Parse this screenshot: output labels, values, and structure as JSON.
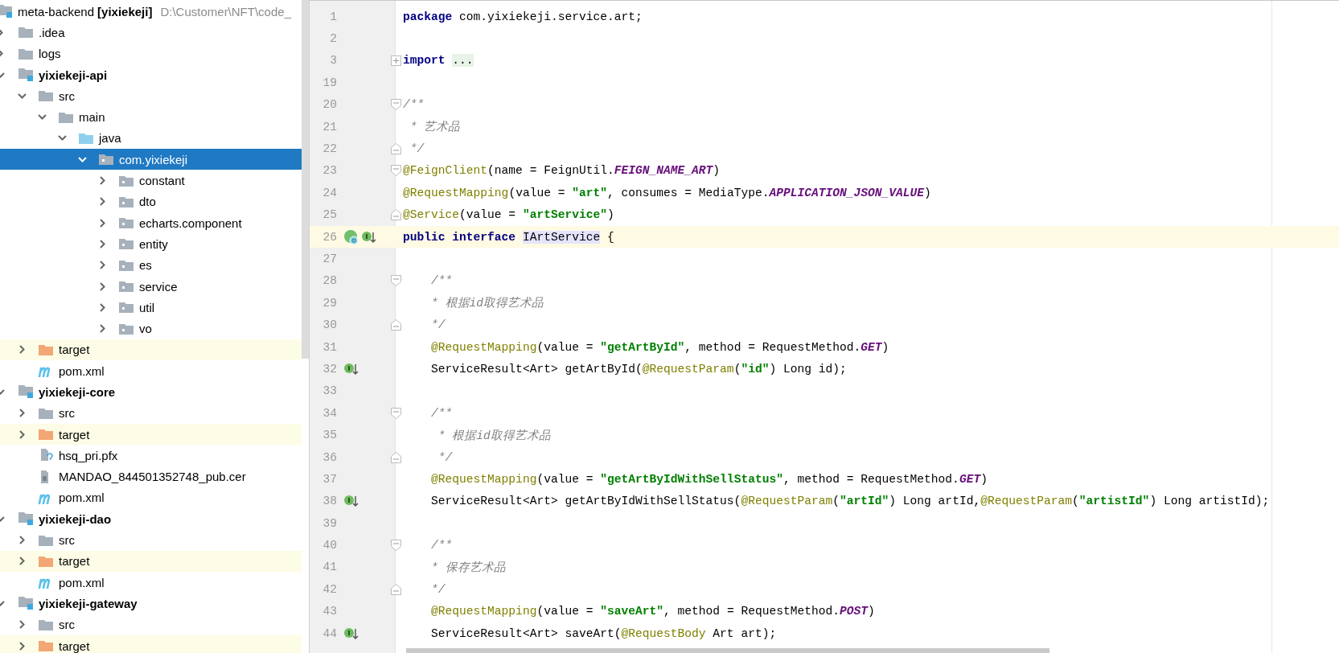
{
  "project_tree": {
    "root": {
      "label": "meta-backend",
      "module": "[yixiekeji]",
      "path": "D:\\Customer\\NFT\\code_"
    },
    "items": [
      {
        "label": ".idea",
        "kind": "folder",
        "expanded": false,
        "selected": false
      },
      {
        "label": "logs",
        "kind": "folder",
        "expanded": false,
        "selected": false
      },
      {
        "label": "yixiekeji-api",
        "kind": "module",
        "expanded": true,
        "selected": false,
        "children": [
          {
            "label": "src",
            "kind": "folder",
            "expanded": true,
            "selected": false,
            "children": [
              {
                "label": "main",
                "kind": "folder",
                "expanded": true,
                "selected": false,
                "children": [
                  {
                    "label": "java",
                    "kind": "source",
                    "expanded": true,
                    "selected": false,
                    "children": [
                      {
                        "label": "com.yixiekeji",
                        "kind": "package",
                        "expanded": true,
                        "selected": true,
                        "children": [
                          {
                            "label": "constant",
                            "kind": "package",
                            "expanded": false,
                            "selected": false
                          },
                          {
                            "label": "dto",
                            "kind": "package",
                            "expanded": false,
                            "selected": false
                          },
                          {
                            "label": "echarts.component",
                            "kind": "package",
                            "expanded": false,
                            "selected": false
                          },
                          {
                            "label": "entity",
                            "kind": "package",
                            "expanded": false,
                            "selected": false
                          },
                          {
                            "label": "es",
                            "kind": "package",
                            "expanded": false,
                            "selected": false
                          },
                          {
                            "label": "service",
                            "kind": "package",
                            "expanded": false,
                            "selected": false
                          },
                          {
                            "label": "util",
                            "kind": "package",
                            "expanded": false,
                            "selected": false
                          },
                          {
                            "label": "vo",
                            "kind": "package",
                            "expanded": false,
                            "selected": false
                          }
                        ]
                      }
                    ]
                  }
                ]
              }
            ]
          },
          {
            "label": "target",
            "kind": "excluded",
            "expanded": false,
            "selected": false
          },
          {
            "label": "pom.xml",
            "kind": "maven",
            "selected": false
          }
        ]
      },
      {
        "label": "yixiekeji-core",
        "kind": "module",
        "expanded": true,
        "selected": false,
        "children": [
          {
            "label": "src",
            "kind": "folder",
            "expanded": false,
            "selected": false
          },
          {
            "label": "target",
            "kind": "excluded",
            "expanded": false,
            "selected": false
          },
          {
            "label": "hsq_pri.pfx",
            "kind": "unknown",
            "selected": false
          },
          {
            "label": "MANDAO_844501352748_pub.cer",
            "kind": "text",
            "selected": false
          },
          {
            "label": "pom.xml",
            "kind": "maven",
            "selected": false
          }
        ]
      },
      {
        "label": "yixiekeji-dao",
        "kind": "module",
        "expanded": true,
        "selected": false,
        "children": [
          {
            "label": "src",
            "kind": "folder",
            "expanded": false,
            "selected": false
          },
          {
            "label": "target",
            "kind": "excluded",
            "expanded": false,
            "selected": false
          },
          {
            "label": "pom.xml",
            "kind": "maven",
            "selected": false
          }
        ]
      },
      {
        "label": "yixiekeji-gateway",
        "kind": "module",
        "expanded": true,
        "selected": false,
        "children": [
          {
            "label": "src",
            "kind": "folder",
            "expanded": false,
            "selected": false
          },
          {
            "label": "target",
            "kind": "excluded",
            "expanded": false,
            "selected": false
          }
        ]
      }
    ]
  },
  "editor": {
    "lines": [
      {
        "number": "1",
        "current": false,
        "tokens": [
          {
            "kind": "keyword",
            "text": "package"
          },
          {
            "kind": "plain",
            "text": " com.yixiekeji.service.art;"
          }
        ]
      },
      {
        "number": "2",
        "current": false
      },
      {
        "number": "3",
        "current": false,
        "fold": {
          "kind": "collapsed"
        },
        "tokens": [
          {
            "kind": "keyword",
            "text": "import"
          },
          {
            "kind": "folded",
            "text": "..."
          }
        ]
      },
      {
        "number": "19",
        "current": false
      },
      {
        "number": "20",
        "current": false,
        "fold": {
          "kind": "start"
        },
        "tokens": [
          {
            "kind": "comment",
            "text": "/**"
          }
        ]
      },
      {
        "number": "21",
        "current": false,
        "tokens": [
          {
            "kind": "comment",
            "text": " * 艺术品"
          }
        ]
      },
      {
        "number": "22",
        "current": false,
        "fold": {
          "kind": "end"
        },
        "tokens": [
          {
            "kind": "comment",
            "text": " */"
          }
        ]
      },
      {
        "number": "23",
        "current": false,
        "fold": {
          "kind": "start"
        },
        "tokens": [
          {
            "kind": "annotation",
            "text": "@FeignClient"
          },
          {
            "kind": "plain",
            "text": "(name = FeignUtil."
          },
          {
            "kind": "constant",
            "text": "FEIGN_NAME_ART"
          },
          {
            "kind": "plain",
            "text": ")"
          }
        ]
      },
      {
        "number": "24",
        "current": false,
        "tokens": [
          {
            "kind": "annotation",
            "text": "@RequestMapping"
          },
          {
            "kind": "plain",
            "text": "(value = "
          },
          {
            "kind": "string",
            "text": "\"art\""
          },
          {
            "kind": "plain",
            "text": ", consumes = MediaType."
          },
          {
            "kind": "constant",
            "text": "APPLICATION_JSON_VALUE"
          },
          {
            "kind": "plain",
            "text": ")"
          }
        ]
      },
      {
        "number": "25",
        "current": false,
        "fold": {
          "kind": "end"
        },
        "tokens": [
          {
            "kind": "annotation",
            "text": "@Service"
          },
          {
            "kind": "plain",
            "text": "(value = "
          },
          {
            "kind": "string",
            "text": "\"artService\""
          },
          {
            "kind": "plain",
            "text": ")"
          }
        ]
      },
      {
        "number": "26",
        "current": true,
        "gutter": [
          {
            "kind": "bean"
          },
          {
            "kind": "implemented"
          }
        ],
        "tokens": [
          {
            "kind": "keyword",
            "text": "public interface"
          },
          {
            "kind": "usage",
            "text": "IArtService"
          },
          {
            "kind": "plain",
            "text": " {"
          }
        ]
      },
      {
        "number": "27",
        "current": false
      },
      {
        "number": "28",
        "current": false,
        "fold": {
          "kind": "start"
        },
        "tokens": [
          {
            "kind": "comment",
            "text": "    /**"
          }
        ]
      },
      {
        "number": "29",
        "current": false,
        "tokens": [
          {
            "kind": "comment",
            "text": "    * 根据id取得艺术品"
          }
        ]
      },
      {
        "number": "30",
        "current": false,
        "fold": {
          "kind": "end"
        },
        "tokens": [
          {
            "kind": "comment",
            "text": "    */"
          }
        ]
      },
      {
        "number": "31",
        "current": false,
        "tokens": [
          {
            "kind": "annotation",
            "text": "    @RequestMapping"
          },
          {
            "kind": "plain",
            "text": "(value = "
          },
          {
            "kind": "string",
            "text": "\"getArtById\""
          },
          {
            "kind": "plain",
            "text": ", method = RequestMethod."
          },
          {
            "kind": "constant",
            "text": "GET"
          },
          {
            "kind": "plain",
            "text": ")"
          }
        ]
      },
      {
        "number": "32",
        "current": false,
        "gutter": [
          {
            "kind": "implemented"
          }
        ],
        "tokens": [
          {
            "kind": "plain",
            "text": "    ServiceResult<Art> getArtById("
          },
          {
            "kind": "annotation",
            "text": "@RequestParam"
          },
          {
            "kind": "plain",
            "text": "("
          },
          {
            "kind": "string",
            "text": "\"id\""
          },
          {
            "kind": "plain",
            "text": ") Long id);"
          }
        ]
      },
      {
        "number": "33",
        "current": false
      },
      {
        "number": "34",
        "current": false,
        "fold": {
          "kind": "start"
        },
        "tokens": [
          {
            "kind": "comment",
            "text": "    /**"
          }
        ]
      },
      {
        "number": "35",
        "current": false,
        "tokens": [
          {
            "kind": "comment",
            "text": "     * 根据id取得艺术品"
          }
        ]
      },
      {
        "number": "36",
        "current": false,
        "fold": {
          "kind": "end"
        },
        "tokens": [
          {
            "kind": "comment",
            "text": "     */"
          }
        ]
      },
      {
        "number": "37",
        "current": false,
        "tokens": [
          {
            "kind": "annotation",
            "text": "    @RequestMapping"
          },
          {
            "kind": "plain",
            "text": "(value = "
          },
          {
            "kind": "string",
            "text": "\"getArtByIdWithSellStatus\""
          },
          {
            "kind": "plain",
            "text": ", method = RequestMethod."
          },
          {
            "kind": "constant",
            "text": "GET"
          },
          {
            "kind": "plain",
            "text": ")"
          }
        ]
      },
      {
        "number": "38",
        "current": false,
        "gutter": [
          {
            "kind": "implemented"
          }
        ],
        "tokens": [
          {
            "kind": "plain",
            "text": "    ServiceResult<Art> getArtByIdWithSellStatus("
          },
          {
            "kind": "annotation",
            "text": "@RequestParam"
          },
          {
            "kind": "plain",
            "text": "("
          },
          {
            "kind": "string",
            "text": "\"artId\""
          },
          {
            "kind": "plain",
            "text": ") Long artId,"
          },
          {
            "kind": "annotation",
            "text": "@RequestParam"
          },
          {
            "kind": "plain",
            "text": "("
          },
          {
            "kind": "string",
            "text": "\"artistId\""
          },
          {
            "kind": "plain",
            "text": ") Long artistId);"
          }
        ]
      },
      {
        "number": "39",
        "current": false
      },
      {
        "number": "40",
        "current": false,
        "fold": {
          "kind": "start"
        },
        "tokens": [
          {
            "kind": "comment",
            "text": "    /**"
          }
        ]
      },
      {
        "number": "41",
        "current": false,
        "tokens": [
          {
            "kind": "comment",
            "text": "    * 保存艺术品"
          }
        ]
      },
      {
        "number": "42",
        "current": false,
        "fold": {
          "kind": "end"
        },
        "tokens": [
          {
            "kind": "comment",
            "text": "    */"
          }
        ]
      },
      {
        "number": "43",
        "current": false,
        "tokens": [
          {
            "kind": "annotation",
            "text": "    @RequestMapping"
          },
          {
            "kind": "plain",
            "text": "(value = "
          },
          {
            "kind": "string",
            "text": "\"saveArt\""
          },
          {
            "kind": "plain",
            "text": ", method = RequestMethod."
          },
          {
            "kind": "constant",
            "text": "POST"
          },
          {
            "kind": "plain",
            "text": ")"
          }
        ]
      },
      {
        "number": "44",
        "current": false,
        "gutter": [
          {
            "kind": "implemented"
          }
        ],
        "tokens": [
          {
            "kind": "plain",
            "text": "    ServiceResult<Art> saveArt("
          },
          {
            "kind": "annotation",
            "text": "@RequestBody"
          },
          {
            "kind": "plain",
            "text": " Art art);"
          }
        ]
      }
    ]
  }
}
